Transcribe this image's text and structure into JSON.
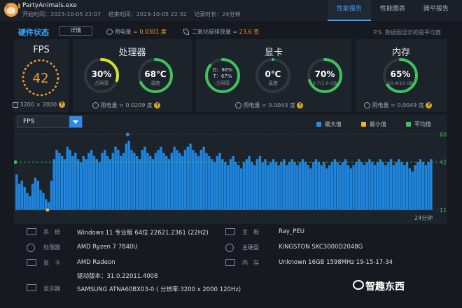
{
  "app": {
    "name": "PartyAnimals.exe",
    "start_label": "开始时间：2023-10-05 22:07",
    "end_label": "结束时间：2023-10-05 22:32",
    "duration_label": "记录时长：24分钟"
  },
  "tabs": [
    {
      "label": "性能报告",
      "active": true
    },
    {
      "label": "性能图表",
      "active": false
    },
    {
      "label": "跨平报告",
      "active": false
    }
  ],
  "status": {
    "title": "硬件状态",
    "detail_button": "详情",
    "usage_prefix": "用电量 = ",
    "usage_value": "0.0301 度",
    "co2_prefix": "二氧化碳排放量 = ",
    "co2_value": "23.6 克",
    "note": "P.S. 数据图显示的是平均值"
  },
  "fps_panel": {
    "title": "FPS",
    "value": "42",
    "resolution": "3200 × 2000"
  },
  "cpu_panel": {
    "title": "处理器",
    "usage_value": "30%",
    "usage_label": "占用率",
    "usage_fraction": 0.3,
    "temp_value": "68℃",
    "temp_label": "温度",
    "temp_fraction": 0.68,
    "power_label": "用电量 = 0.0209 度"
  },
  "gpu_panel": {
    "title": "显卡",
    "d_line": "D：86%",
    "t_line": "T：67%",
    "sub_label": "占用率",
    "usage_fraction": 0.86,
    "temp_value": "0℃",
    "temp_label": "温度",
    "temp_fraction": 0.0,
    "mem_value": "70%",
    "mem_label": "0.7/1.0 GB",
    "mem_fraction": 0.7,
    "power_label": "用电量 = 0.0043 度"
  },
  "mem_panel": {
    "title": "内存",
    "value": "65%",
    "label": "10.4/16 GB",
    "fraction": 0.65,
    "power_label": "用电量 = 0.0049 度"
  },
  "chart_data": {
    "type": "area",
    "selector": "FPS",
    "legend": [
      {
        "name": "最大值",
        "color": "#2d8ae8"
      },
      {
        "name": "最小值",
        "color": "#f0b429"
      },
      {
        "name": "平均值",
        "color": "#3fc15b"
      }
    ],
    "ymax_label": "60",
    "ymin_label": "11",
    "avg_label": "42.02",
    "ymax": 60,
    "ymin": 11,
    "avg": 42.02,
    "x_end_label": "24分钟",
    "values": [
      34,
      28,
      30,
      26,
      22,
      20,
      28,
      32,
      30,
      24,
      22,
      18,
      16,
      30,
      44,
      50,
      48,
      46,
      44,
      52,
      50,
      46,
      48,
      44,
      42,
      46,
      44,
      48,
      50,
      46,
      44,
      42,
      48,
      50,
      46,
      44,
      48,
      52,
      50,
      46,
      48,
      54,
      56,
      50,
      48,
      46,
      44,
      50,
      52,
      48,
      46,
      44,
      48,
      50,
      52,
      48,
      46,
      44,
      48,
      52,
      50,
      48,
      46,
      50,
      52,
      54,
      50,
      48,
      46,
      50,
      52,
      48,
      46,
      44,
      42,
      46,
      48,
      44,
      42,
      40,
      44,
      46,
      42,
      40,
      38,
      42,
      44,
      46,
      42,
      40,
      44,
      46,
      42,
      44,
      40,
      42,
      44,
      42,
      40,
      42,
      44,
      40,
      42,
      44,
      42,
      40,
      42,
      44,
      42,
      40,
      38,
      42,
      44,
      42,
      40,
      42,
      38,
      40,
      42,
      44,
      42,
      40,
      42,
      44,
      40,
      38,
      40,
      42,
      44,
      42,
      40,
      42,
      44,
      42,
      40,
      42,
      44,
      42,
      40,
      42,
      44,
      40,
      42,
      44,
      42,
      40,
      42,
      38,
      36,
      40,
      42,
      44,
      42,
      40,
      42,
      44
    ]
  },
  "system": {
    "left": [
      {
        "label": "系　统",
        "value": "Windows 11 专业版 64位 22621.2361 (22H2)",
        "icon": "windows-icon"
      },
      {
        "label": "处理器",
        "value": "AMD Ryzen 7 7840U",
        "icon": "cpu-icon"
      },
      {
        "label": "显　卡",
        "value": "AMD Radeon",
        "icon": "gpu-icon"
      },
      {
        "label": "",
        "value": "驱动版本：31.0.22011.4008",
        "icon": ""
      },
      {
        "label": "显示器",
        "value": "SAMSUNG ATNA60BX03-0 ( 分辨率:3200 x 2000 120Hz)",
        "icon": "monitor-icon"
      }
    ],
    "right": [
      {
        "label": "主　板",
        "value": "Ray_PEU",
        "icon": "motherboard-icon"
      },
      {
        "label": "主硬盘",
        "value": "KINGSTON SKC3000D2048G",
        "icon": "disk-icon"
      },
      {
        "label": "内　存",
        "value": "Unknown 16GB 1598MHz 19-15-17-34",
        "icon": "memory-icon"
      }
    ]
  },
  "watermark": "智趣东西"
}
